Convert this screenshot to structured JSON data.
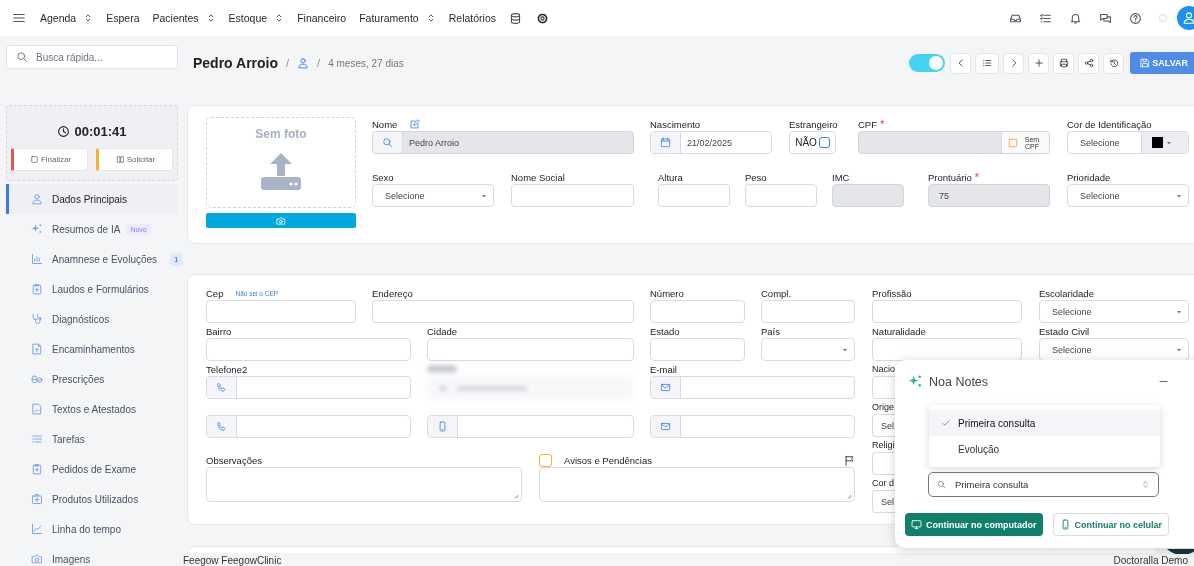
{
  "topbar": {
    "menu": [
      {
        "label": "Agenda",
        "dropdown": true
      },
      {
        "label": "Espera",
        "dropdown": false
      },
      {
        "label": "Pacientes",
        "dropdown": true
      },
      {
        "label": "Estoque",
        "dropdown": true
      },
      {
        "label": "Financeiro",
        "dropdown": false
      },
      {
        "label": "Faturamento",
        "dropdown": true
      },
      {
        "label": "Relatórios",
        "dropdown": false
      }
    ]
  },
  "search": {
    "placeholder": "Busca rápida..."
  },
  "timer": {
    "time": "00:01:41",
    "buttons": [
      {
        "label": "Finalizar",
        "kind": "finish"
      },
      {
        "label": "Solicitar",
        "kind": "request"
      }
    ]
  },
  "sidebar": {
    "items": [
      {
        "label": "Dados Principais",
        "selected": true
      },
      {
        "label": "Resumos de IA",
        "selected": false,
        "badge": {
          "text": "Novo",
          "kind": "new"
        }
      },
      {
        "label": "Anamnese e Evoluções",
        "selected": false,
        "badge": {
          "text": "1",
          "kind": "count"
        }
      },
      {
        "label": "Laudos e Formulários",
        "selected": false
      },
      {
        "label": "Diagnósticos",
        "selected": false
      },
      {
        "label": "Encaminhamentos",
        "selected": false
      },
      {
        "label": "Prescrições",
        "selected": false
      },
      {
        "label": "Textos e Atestados",
        "selected": false
      },
      {
        "label": "Tarefas",
        "selected": false
      },
      {
        "label": "Pedidos de Exame",
        "selected": false
      },
      {
        "label": "Produtos Utilizados",
        "selected": false
      },
      {
        "label": "Linha do tempo",
        "selected": false
      },
      {
        "label": "Imagens",
        "selected": false
      }
    ]
  },
  "breadcrumb": [
    {
      "kind": "name",
      "text": "Pedro Arroio"
    },
    {
      "kind": "separator",
      "text": "/"
    },
    {
      "kind": "user"
    },
    {
      "kind": "separator",
      "text": "/"
    },
    {
      "kind": "age",
      "text": "4 meses, 27 dias"
    }
  ],
  "toolbar": {
    "toggle_on": true,
    "save_label": "SALVAR"
  },
  "profile_card": {
    "photo": {
      "placeholder": "Sem foto"
    },
    "fields": [
      {
        "label": "Nome",
        "kind": "search",
        "value": "Pedro Arroio",
        "editable": true,
        "disabled": true
      },
      {
        "label": "Nascimento",
        "kind": "date",
        "value": "21/02/2025",
        "disabled": false
      },
      {
        "label": "Estrangeiro",
        "kind": "checkbox",
        "value": "NÃO",
        "checked": false,
        "disabled": false
      },
      {
        "label": "CPF",
        "required_mark": "*",
        "kind": "cpf",
        "button": "Sem CPF",
        "disabled": true
      },
      {
        "label": "Cor de Identificação",
        "kind": "color",
        "value": "Selecione",
        "color": "#000000",
        "disabled": false
      },
      {
        "label": "Sexo",
        "kind": "select",
        "value": "Selecione",
        "disabled": false
      },
      {
        "label": "Nome Social",
        "kind": "text",
        "disabled": false
      },
      {
        "label": "Altura",
        "kind": "text",
        "disabled": false
      },
      {
        "label": "Peso",
        "kind": "text",
        "disabled": false
      },
      {
        "label": "IMC",
        "kind": "text",
        "disabled": true
      },
      {
        "label": "Prontuário",
        "required_mark": "*",
        "kind": "text",
        "value": "75",
        "disabled": true
      },
      {
        "label": "Prioridade",
        "kind": "select",
        "value": "Selecione",
        "disabled": false
      }
    ]
  },
  "address_card": {
    "rows": [
      [
        {
          "label": "Cep",
          "link": "Não sei o CEP",
          "kind": "text",
          "disabled": false
        },
        {
          "label": "Endereço",
          "kind": "text",
          "disabled": false
        },
        {
          "label": "Número",
          "kind": "text",
          "disabled": false
        },
        {
          "label": "Compl.",
          "kind": "text",
          "disabled": false
        }
      ],
      [
        {
          "label": "Bairro",
          "kind": "text",
          "disabled": false
        },
        {
          "label": "Cidade",
          "kind": "text",
          "disabled": false
        },
        {
          "label": "Estado",
          "kind": "text",
          "disabled": false
        },
        {
          "label": "País",
          "kind": "select",
          "disabled": false
        }
      ],
      [
        {
          "label": "Telefone2",
          "kind": "phone",
          "disabled": false
        },
        {
          "kind": "blurred"
        },
        {
          "label": "E-mail",
          "kind": "email",
          "disabled": false
        }
      ],
      [
        {
          "kind": "phone",
          "disabled": false
        },
        {
          "kind": "mobile",
          "disabled": false
        },
        {
          "kind": "email",
          "disabled": false
        }
      ]
    ],
    "side_columns": [
      [
        {
          "label": "Profissão",
          "kind": "text",
          "disabled": false
        },
        {
          "label": "Naturalidade",
          "kind": "text",
          "disabled": false
        },
        {
          "label": "Nacio",
          "kind": "text",
          "disabled": false
        },
        {
          "label": "Orige",
          "kind": "text",
          "value": "Sel",
          "disabled": false
        },
        {
          "label": "Religi",
          "kind": "text",
          "disabled": false
        },
        {
          "label": "Cor d",
          "kind": "text",
          "value": "Sel",
          "disabled": false
        }
      ],
      [
        {
          "label": "Escolaridade",
          "kind": "select",
          "value": "Selecione",
          "disabled": false
        },
        {
          "label": "Estado Civil",
          "kind": "select",
          "value": "Selecione",
          "disabled": false
        }
      ]
    ],
    "notes": [
      {
        "label": "Observações",
        "kind": "textarea",
        "disabled": false
      },
      {
        "label": "Avisos e Pendências",
        "kind": "notice",
        "checked": false,
        "disabled": false
      }
    ]
  },
  "noa_notes": {
    "title": "Noa Notes",
    "options": [
      {
        "label": "Primeira consulta",
        "selected": true
      },
      {
        "label": "Evolução",
        "selected": false
      }
    ],
    "select_value": "Primeira consulta",
    "buttons": [
      {
        "label": "Continuar no computador",
        "kind": "primary"
      },
      {
        "label": "Continuar no celular",
        "kind": "secondary"
      }
    ]
  },
  "footer": {
    "left": "Feegow FeegowClinic",
    "right": "Doctoralla Demo"
  }
}
